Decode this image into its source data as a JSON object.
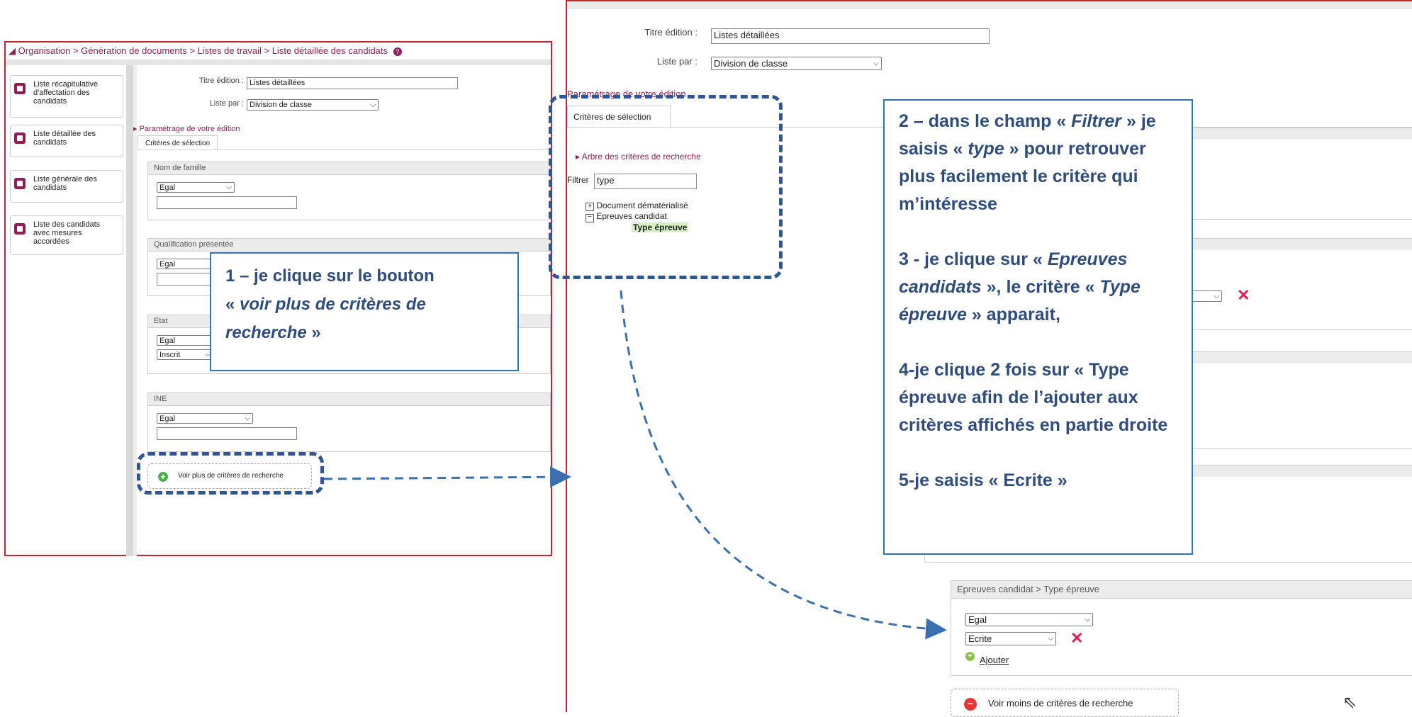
{
  "left": {
    "breadcrumb": "Organisation > Génération de documents > Listes de travail > Liste détaillée des candidats",
    "help_icon": "?",
    "sidebar": [
      {
        "label": "Liste récapitulative d'affectation des candidats"
      },
      {
        "label": "Liste détaillée des candidats"
      },
      {
        "label": "Liste générale des candidats"
      },
      {
        "label": "Liste des candidats avec mesures accordées"
      }
    ],
    "titre_label": "Titre édition :",
    "titre_value": "Listes détaillées",
    "liste_par_label": "Liste par :",
    "liste_par_value": "Division de classe",
    "param_link": "Paramétrage de votre édition",
    "tab": "Critères de sélection",
    "panels": [
      {
        "title": "Nom de famille",
        "op": "Egal"
      },
      {
        "title": "Qualification présentée",
        "op": "Egal"
      },
      {
        "title": "Etat",
        "op": "Egal",
        "value": "Inscrit"
      },
      {
        "title": "INE",
        "op": "Egal"
      }
    ],
    "more_button": "Voir plus de critères de recherche"
  },
  "callout1": {
    "line1": "1 – je clique sur le bouton",
    "line2_pre": "« ",
    "line2_em": "voir plus de critères de recherche",
    "line2_post": " »"
  },
  "right": {
    "titre_label": "Titre édition :",
    "titre_value": "Listes détaillées",
    "liste_par_label": "Liste par :",
    "liste_par_value": "Division de classe",
    "param_link": "Paramétrage de votre édition",
    "tab": "Critères de sélection",
    "tree_link": "Arbre des critères de recherche",
    "filter_label": "Filtrer",
    "filter_value": "type",
    "tree": {
      "node1": "Document dématérialisé",
      "node2": "Epreuves candidat",
      "leaf": "Type épreuve"
    },
    "panel_title": "Epreuves candidat > Type épreuve",
    "op": "Egal",
    "value": "Ecrite",
    "add_link": "Ajouter",
    "less_button": "Voir moins de critères de recherche"
  },
  "callout2": {
    "p1_a": "2 – dans le champ « ",
    "p1_em": "Filtrer",
    "p1_b": " » je saisis « ",
    "p1_em2": "type",
    "p1_c": " » pour retrouver plus facilement le critère qui m’intéresse",
    "p2_a": "3 - je clique sur « ",
    "p2_em": "Epreuves candidats",
    "p2_b": " », le critère « ",
    "p2_em2": "Type épreuve",
    "p2_c": " » apparait,",
    "p3": "4-je clique 2 fois sur « Type épreuve afin de l’ajouter aux critères affichés en partie droite",
    "p4": "5-je saisis « Ecrite »"
  },
  "colors": {
    "border_red": "#c0272d",
    "callout_blue": "#2e75b6",
    "dash_blue": "#2f5597",
    "accent_magenta": "#8e1f54"
  }
}
